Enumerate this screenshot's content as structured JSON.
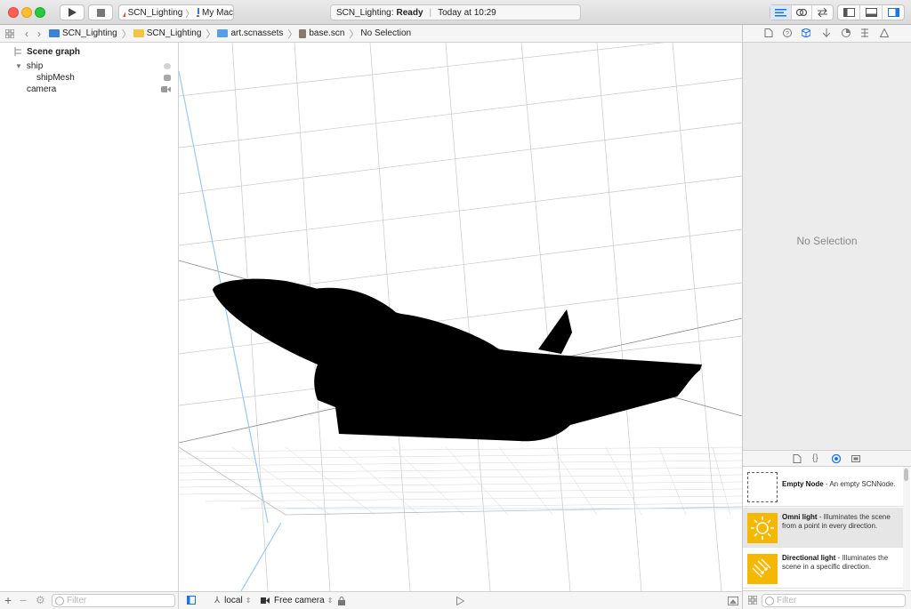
{
  "toolbar": {
    "scheme_name": "SCN_Lighting",
    "destination": "My Mac",
    "status_app": "SCN_Lighting:",
    "status_state": "Ready",
    "status_time": "Today at 10:29"
  },
  "jumpbar": {
    "crumbs": [
      "SCN_Lighting",
      "SCN_Lighting",
      "art.scnassets",
      "base.scn",
      "No Selection"
    ]
  },
  "scene_graph": {
    "title": "Scene graph",
    "nodes": [
      {
        "label": "ship",
        "icon": "node-icon"
      },
      {
        "label": "shipMesh",
        "icon": "geometry-icon"
      },
      {
        "label": "camera",
        "icon": "camera-icon"
      }
    ],
    "filter_placeholder": "Filter"
  },
  "viewport": {
    "coordinate_space": "local",
    "camera": "Free camera"
  },
  "inspector": {
    "empty_message": "No Selection"
  },
  "library": {
    "items": [
      {
        "title": "Empty Node",
        "desc": " - An empty SCNNode."
      },
      {
        "title": "Omni light",
        "desc": " - Illuminates the scene from a point in every direction."
      },
      {
        "title": "Directional light",
        "desc": " - Illuminates the scene in a specific direction."
      }
    ],
    "filter_placeholder": "Filter"
  },
  "colors": {
    "accent": "#1a73e8",
    "light_yellow": "#f5b800",
    "folder_yellow": "#f4c542",
    "grid_line": "#c8c8c8",
    "axis_blue": "#9cc8f0"
  }
}
